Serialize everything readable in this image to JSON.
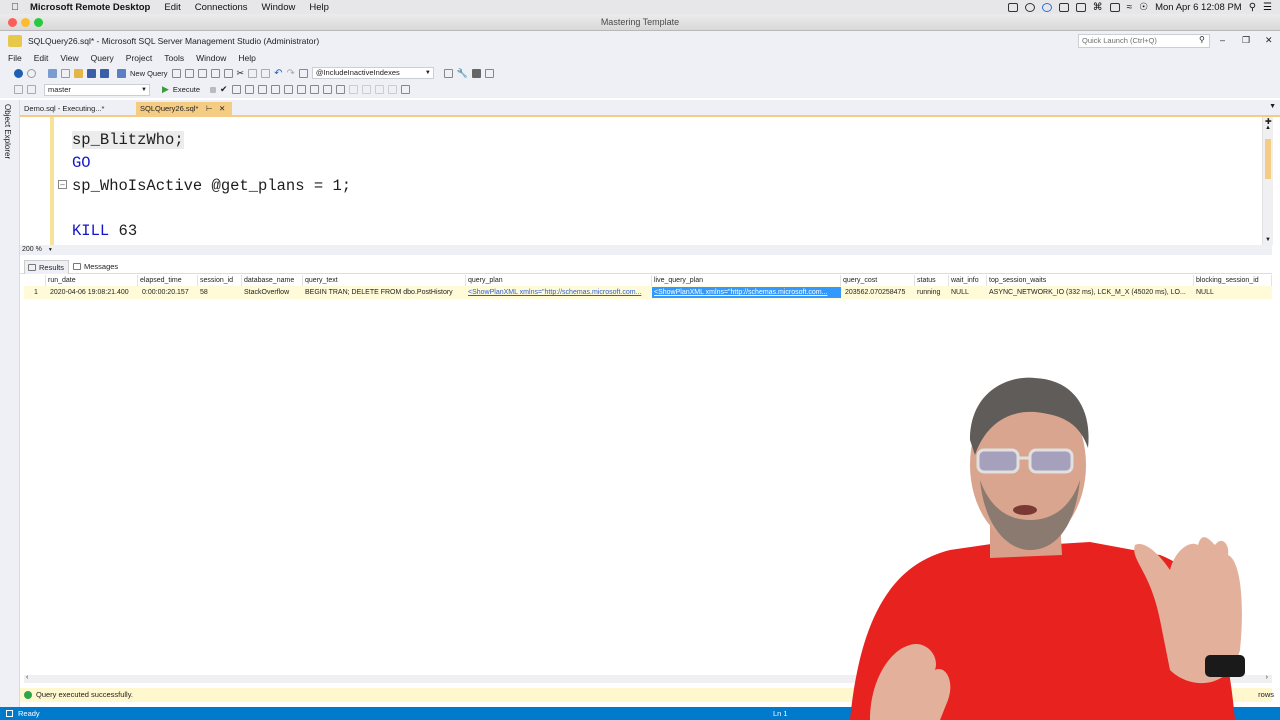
{
  "mac_menubar": {
    "app": "Microsoft Remote Desktop",
    "items": [
      "Edit",
      "Connections",
      "Window",
      "Help"
    ],
    "clock": "Mon Apr 6  12:08 PM"
  },
  "window_title": "Mastering Template",
  "ssms": {
    "title": "SQLQuery26.sql* - Microsoft SQL Server Management Studio (Administrator)",
    "quick_launch_placeholder": "Quick Launch (Ctrl+Q)",
    "menu": [
      "File",
      "Edit",
      "View",
      "Query",
      "Project",
      "Tools",
      "Window",
      "Help"
    ],
    "toolbar": {
      "new_query": "New Query",
      "param_combo": "@IncludeInactiveIndexes",
      "database": "master",
      "execute": "Execute"
    }
  },
  "sidebar_label": "Object Explorer",
  "doc_tabs": [
    {
      "label": "Demo.sql - Executing...*"
    },
    {
      "label": "SQLQuery26.sql*"
    }
  ],
  "editor": {
    "lines": {
      "l1": "sp_BlitzWho;",
      "l2": "GO",
      "l3a": "sp_WhoIsActive @get_plans = 1;",
      "l4a": "KILL",
      "l4b": " 63"
    },
    "zoom": "200 %"
  },
  "result_tabs": [
    "Results",
    "Messages"
  ],
  "grid": {
    "columns": [
      "run_date",
      "elapsed_time",
      "session_id",
      "database_name",
      "query_text",
      "query_plan",
      "live_query_plan",
      "query_cost",
      "status",
      "wait_info",
      "top_session_waits",
      "blocking_session_id"
    ],
    "rows": [
      {
        "num": "1",
        "run_date": "2020-04-06 19:08:21.400",
        "elapsed_time": "0:00:00:20.157",
        "session_id": "58",
        "database_name": "StackOverflow",
        "query_text": "BEGIN TRAN;  DELETE FROM dbo.PostHistory",
        "query_plan": "<ShowPlanXML xmlns=\"http://schemas.microsoft.com...",
        "live_query_plan": "<ShowPlanXML xmlns=\"http://schemas.microsoft.com...",
        "query_cost": "203562.070258475",
        "status": "running",
        "wait_info": "NULL",
        "top_session_waits": "ASYNC_NETWORK_IO (332 ms), LCK_M_X (45020 ms), LO...",
        "blocking_session_id": "NULL"
      }
    ]
  },
  "query_status": "Query executed successfully.",
  "query_status_right": "rows",
  "statusbar": {
    "left": "Ready",
    "ln": "Ln 1"
  }
}
